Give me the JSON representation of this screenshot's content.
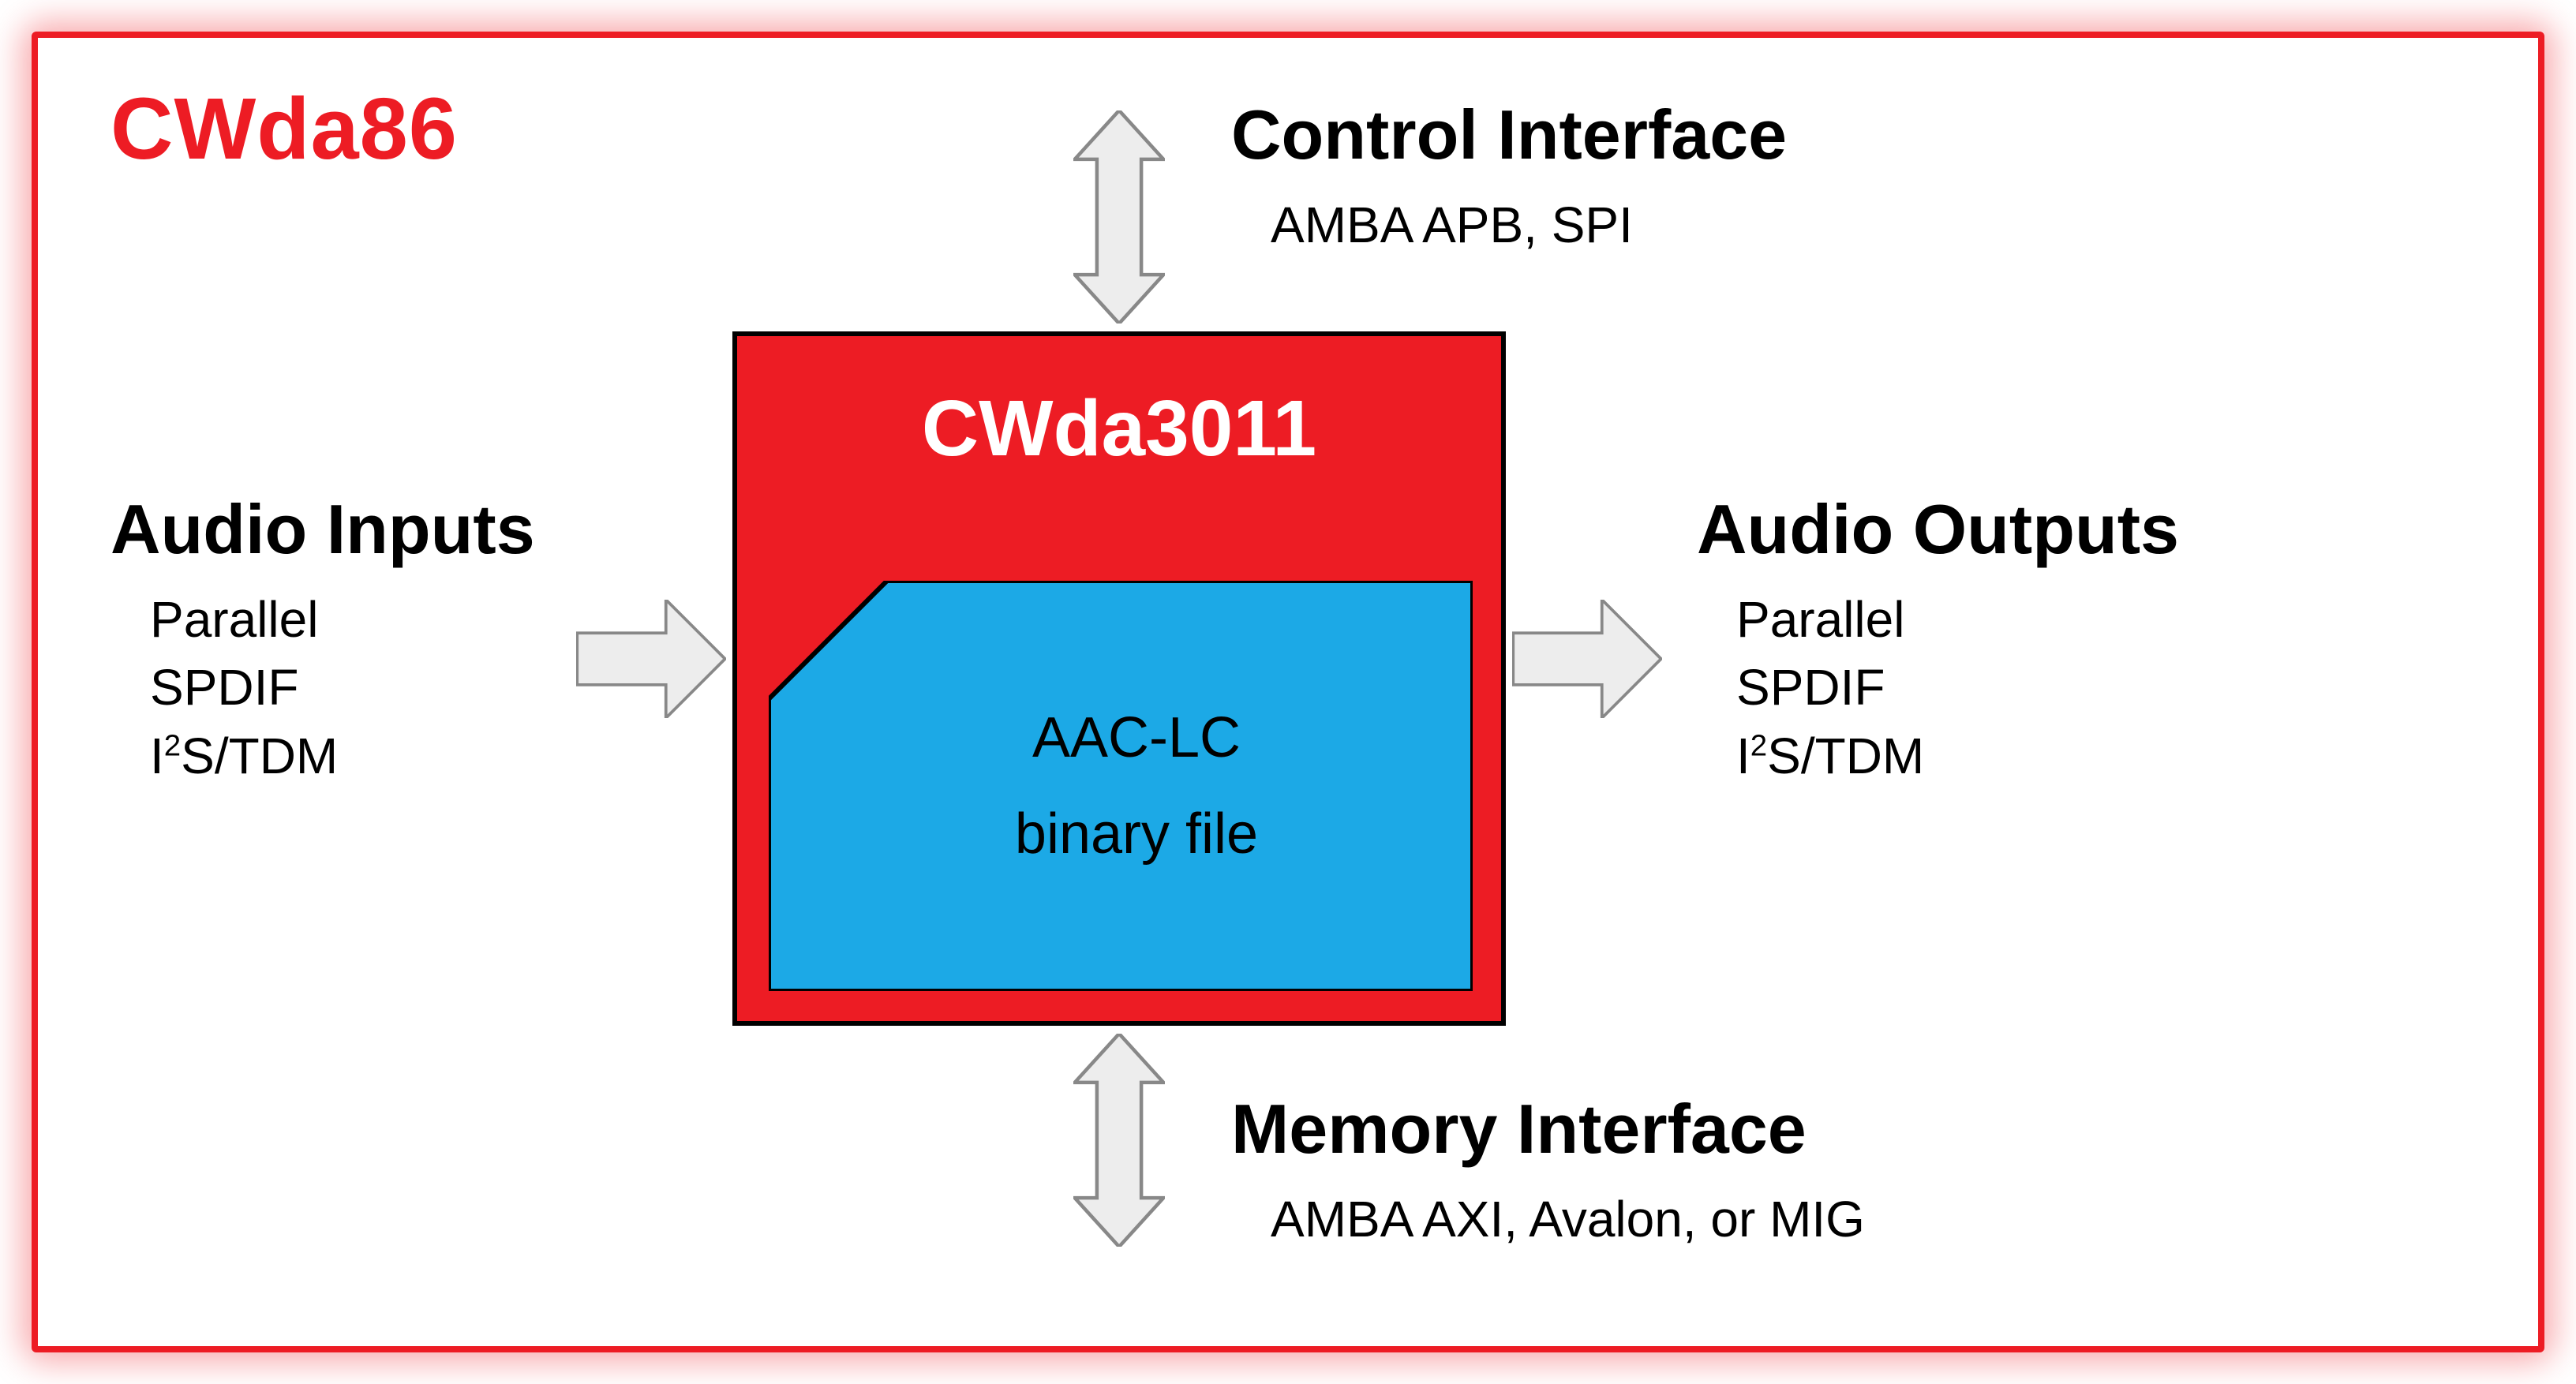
{
  "title": "CWda86",
  "core": {
    "name": "CWda3011",
    "inner": {
      "line1": "AAC-LC",
      "line2": "binary file"
    }
  },
  "top": {
    "heading": "Control Interface",
    "line1": "AMBA APB, SPI"
  },
  "bottom": {
    "heading": "Memory Interface",
    "line1": "AMBA AXI, Avalon, or MIG"
  },
  "left": {
    "heading": "Audio Inputs",
    "line1": "Parallel",
    "line2": "SPDIF",
    "line3_pre": "I",
    "line3_sup": "2",
    "line3_post": "S/TDM"
  },
  "right": {
    "heading": "Audio Outputs",
    "line1": "Parallel",
    "line2": "SPDIF",
    "line3_pre": "I",
    "line3_sup": "2",
    "line3_post": "S/TDM"
  },
  "colors": {
    "red": "#ed1c24",
    "blue": "#1ca9e6",
    "arrow_fill": "#ededed",
    "arrow_stroke": "#888888",
    "black": "#000000"
  }
}
